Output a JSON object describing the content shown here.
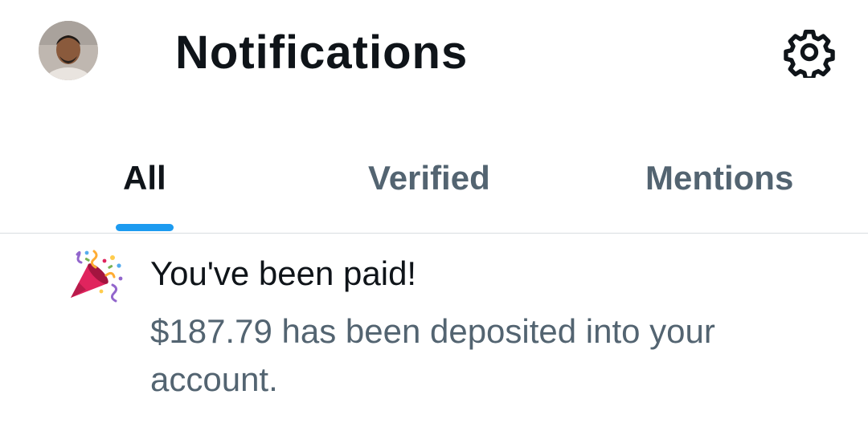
{
  "header": {
    "title": "Notifications",
    "avatar_icon": "user-avatar",
    "settings_icon": "gear-icon"
  },
  "tabs": [
    {
      "label": "All",
      "active": true
    },
    {
      "label": "Verified",
      "active": false
    },
    {
      "label": "Mentions",
      "active": false
    }
  ],
  "notification": {
    "icon": "party-popper-icon",
    "title": "You've been paid!",
    "body": "$187.79 has been deposited into your account."
  },
  "colors": {
    "accent": "#1d9bf0",
    "text_primary": "#0f1419",
    "text_secondary": "#536471",
    "divider": "#d9dde1"
  }
}
